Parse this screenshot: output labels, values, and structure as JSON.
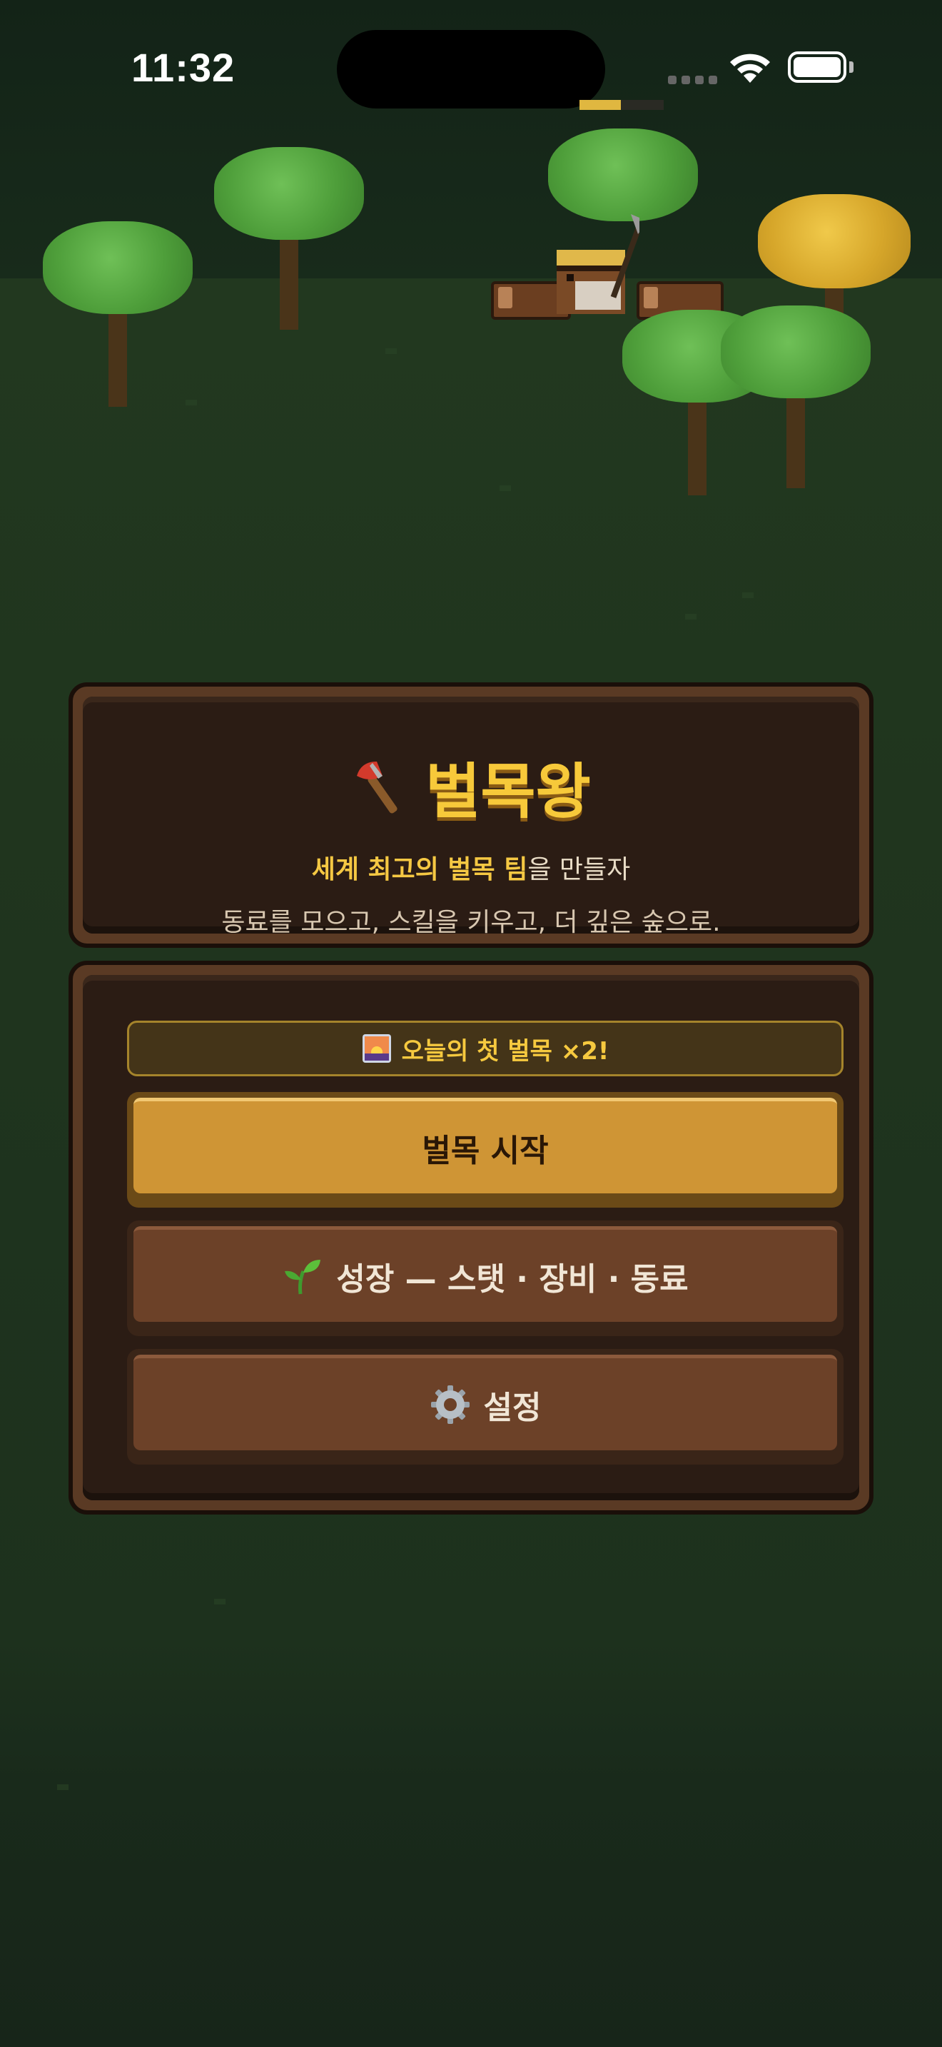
{
  "status_bar": {
    "time": "11:32"
  },
  "icons": {
    "axe": "axe-icon",
    "sunrise": "sunrise-icon",
    "sprout": "sprout-icon",
    "gear": "gear-icon",
    "wifi": "wifi-icon",
    "battery": "battery-icon"
  },
  "title_panel": {
    "title": "벌목왕",
    "tagline_highlight": "세계 최고의 벌목 팀",
    "tagline_rest": "을 만들자",
    "description": "동료를 모으고, 스킬을 키우고, 더 깊은 숲으로."
  },
  "menu": {
    "bonus_text": "오늘의 첫 벌목 ×2!",
    "start_label": "벌목 시작",
    "growth_label": "성장 — 스탯 · 장비 · 동료",
    "settings_label": "설정"
  },
  "colors": {
    "accent_gold": "#f7c93a",
    "panel_wood": "#5a3a24",
    "button_primary": "#cf9535",
    "button_secondary": "#6c4128",
    "background": "#1f341e"
  }
}
